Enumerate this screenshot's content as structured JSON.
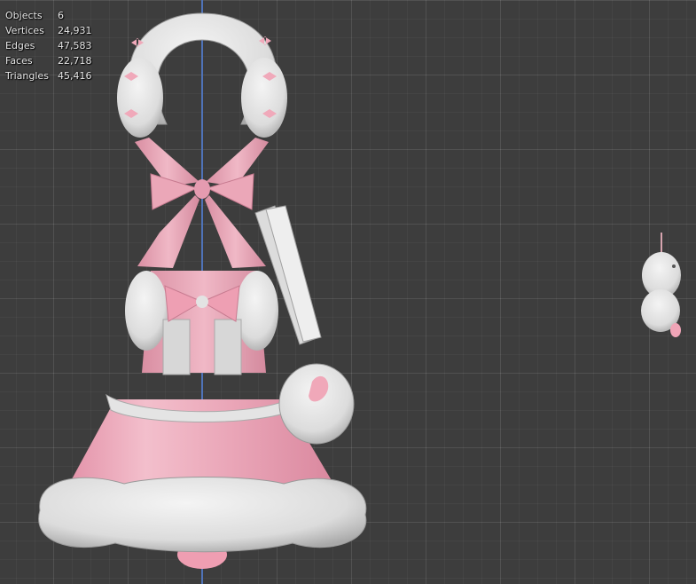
{
  "stats": [
    {
      "label": "Objects",
      "value": "6"
    },
    {
      "label": "Vertices",
      "value": "24,931"
    },
    {
      "label": "Edges",
      "value": "47,583"
    },
    {
      "label": "Faces",
      "value": "22,718"
    },
    {
      "label": "Triangles",
      "value": "45,416"
    }
  ],
  "colors": {
    "background": "#3d3d3d",
    "grid": "#4a4a4a",
    "z_axis": "#4f73b8",
    "pink": "#e7a8b8",
    "pink_dark": "#c9788f",
    "fluff": "#ececec",
    "fluff_shade": "#b9b9b9"
  },
  "objects": [
    "headband-with-bows",
    "neck-bow-collar",
    "dress-bodice",
    "dress-skirt",
    "shoulder-bag",
    "plush-bunny"
  ]
}
